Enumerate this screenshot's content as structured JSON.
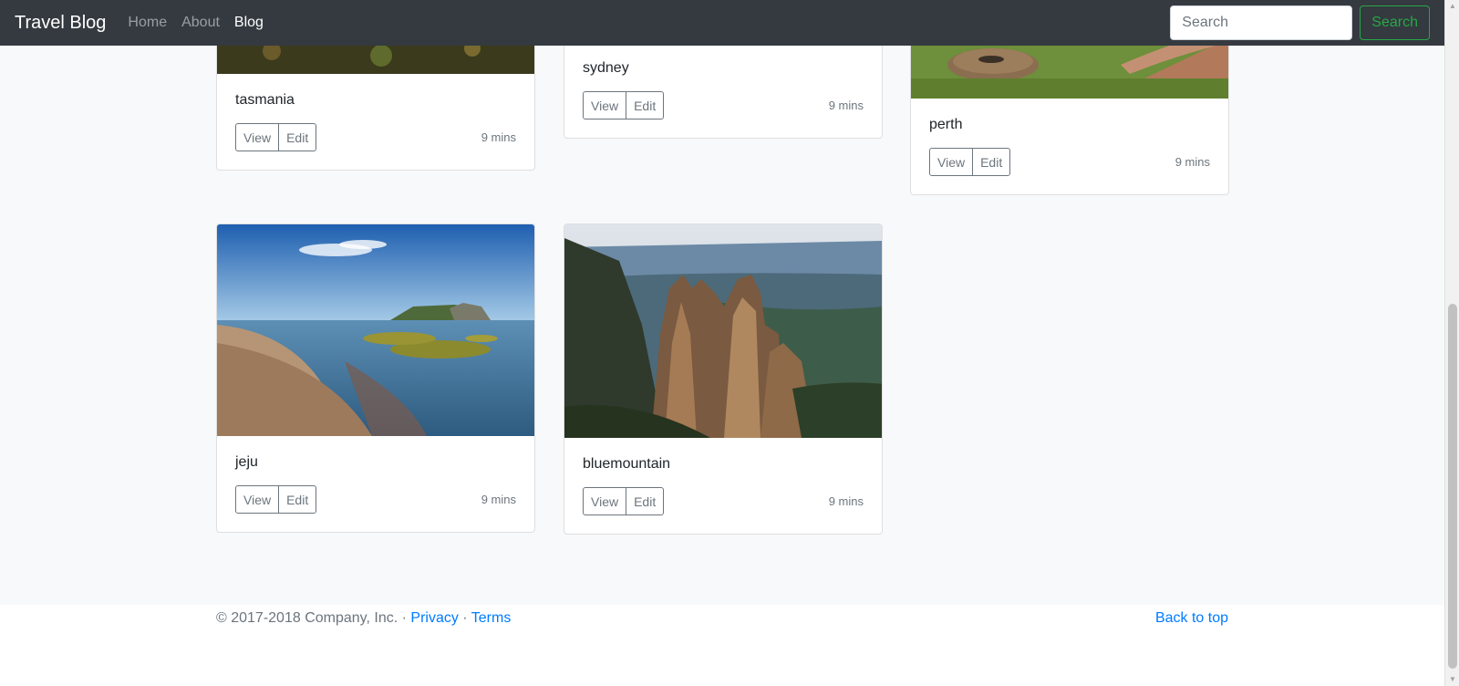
{
  "navbar": {
    "brand": "Travel Blog",
    "links": [
      "Home",
      "About",
      "Blog"
    ],
    "active": "Blog",
    "search_placeholder": "Search",
    "search_button": "Search"
  },
  "cards": [
    {
      "title": "tasmania",
      "view": "View",
      "edit": "Edit",
      "time": "9 mins"
    },
    {
      "title": "sydney",
      "view": "View",
      "edit": "Edit",
      "time": "9 mins"
    },
    {
      "title": "perth",
      "view": "View",
      "edit": "Edit",
      "time": "9 mins"
    },
    {
      "title": "jeju",
      "view": "View",
      "edit": "Edit",
      "time": "9 mins"
    },
    {
      "title": "bluemountain",
      "view": "View",
      "edit": "Edit",
      "time": "9 mins"
    }
  ],
  "footer": {
    "copyright": "© 2017-2018 Company, Inc. · ",
    "privacy": "Privacy",
    "separator": " · ",
    "terms": "Terms",
    "back_to_top": "Back to top"
  }
}
